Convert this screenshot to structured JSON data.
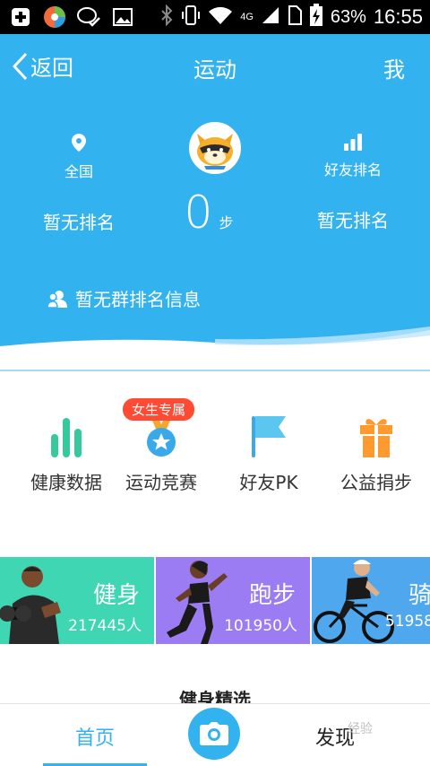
{
  "status_bar": {
    "battery": "63%",
    "time": "16:55",
    "signal": "4G"
  },
  "header": {
    "back_label": "返回",
    "title": "运动",
    "me_label": "我"
  },
  "stats": {
    "left": {
      "label": "全国",
      "value": "暂无排名"
    },
    "right": {
      "label": "好友排名",
      "value": "暂无排名"
    },
    "steps": "0",
    "steps_unit": "步",
    "group_text": "暂无群排名信息"
  },
  "features": [
    {
      "label": "健康数据",
      "icon": "bar-chart-icon"
    },
    {
      "label": "运动竞赛",
      "icon": "medal-icon",
      "badge": "女生专属"
    },
    {
      "label": "好友PK",
      "icon": "flag-icon"
    },
    {
      "label": "公益捐步",
      "icon": "gift-icon"
    }
  ],
  "cards": [
    {
      "title": "健身",
      "count": "217445人",
      "color": "#3fd6b4"
    },
    {
      "title": "跑步",
      "count": "101950人",
      "color": "#9b7cf2"
    },
    {
      "title": "骑",
      "count": "51958",
      "color": "#4fa7ee"
    }
  ],
  "section_title": "健身精选",
  "bottom_nav": {
    "home": "首页",
    "discover": "发现"
  },
  "watermark": "经验",
  "colors": {
    "accent": "#33b2f0",
    "badge": "#ff4a34",
    "green": "#35c99d",
    "orange": "#ff9a2e"
  }
}
